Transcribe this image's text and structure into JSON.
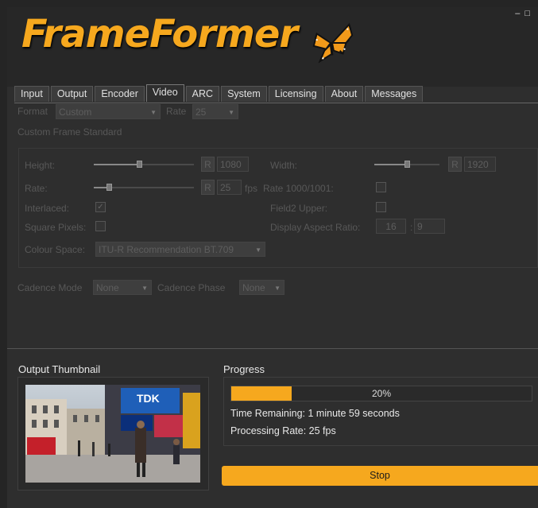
{
  "app": {
    "title": "FrameFormer"
  },
  "window_controls": [
    "–",
    "□"
  ],
  "tabs": [
    "Input",
    "Output",
    "Encoder",
    "Video",
    "ARC",
    "System",
    "Licensing",
    "About",
    "Messages"
  ],
  "active_tab": "Video",
  "video": {
    "format_label": "Format",
    "format_value": "Custom",
    "rate_label": "Rate",
    "rate_value": "25",
    "custom_frame_standard_label": "Custom Frame Standard",
    "height_label": "Height:",
    "height_value": "1080",
    "height_slider_fraction": 0.45,
    "width_label": "Width:",
    "width_value": "1920",
    "width_slider_fraction": 0.5,
    "rate_row_label": "Rate:",
    "rate_row_value": "25",
    "rate_slider_fraction": 0.15,
    "fps_label": "fps",
    "rate_1001_label": "Rate 1000/1001:",
    "interlaced_label": "Interlaced:",
    "interlaced_checked": true,
    "field2_upper_label": "Field2 Upper:",
    "square_pixels_label": "Square Pixels:",
    "dar_label": "Display Aspect Ratio:",
    "dar_w": "16",
    "dar_sep": ":",
    "dar_h": "9",
    "colour_space_label": "Colour Space:",
    "colour_space_value": "ITU-R Recommendation BT.709",
    "r_button": "R",
    "cadence_mode_label": "Cadence Mode",
    "cadence_mode_value": "None",
    "cadence_phase_label": "Cadence Phase",
    "cadence_phase_value": "None"
  },
  "thumbnail": {
    "title": "Output Thumbnail",
    "billboard_text": "TDK"
  },
  "progress": {
    "title": "Progress",
    "percent": 20,
    "percent_text": "20%",
    "time_remaining_label": "Time Remaining:",
    "time_remaining_value": "1 minute 59 seconds",
    "processing_rate_label": "Processing Rate:",
    "processing_rate_value": "25 fps"
  },
  "stop_button": "Stop",
  "colors": {
    "accent": "#f6a81e",
    "background": "#2e2e2e",
    "disabled_text": "#585858"
  }
}
